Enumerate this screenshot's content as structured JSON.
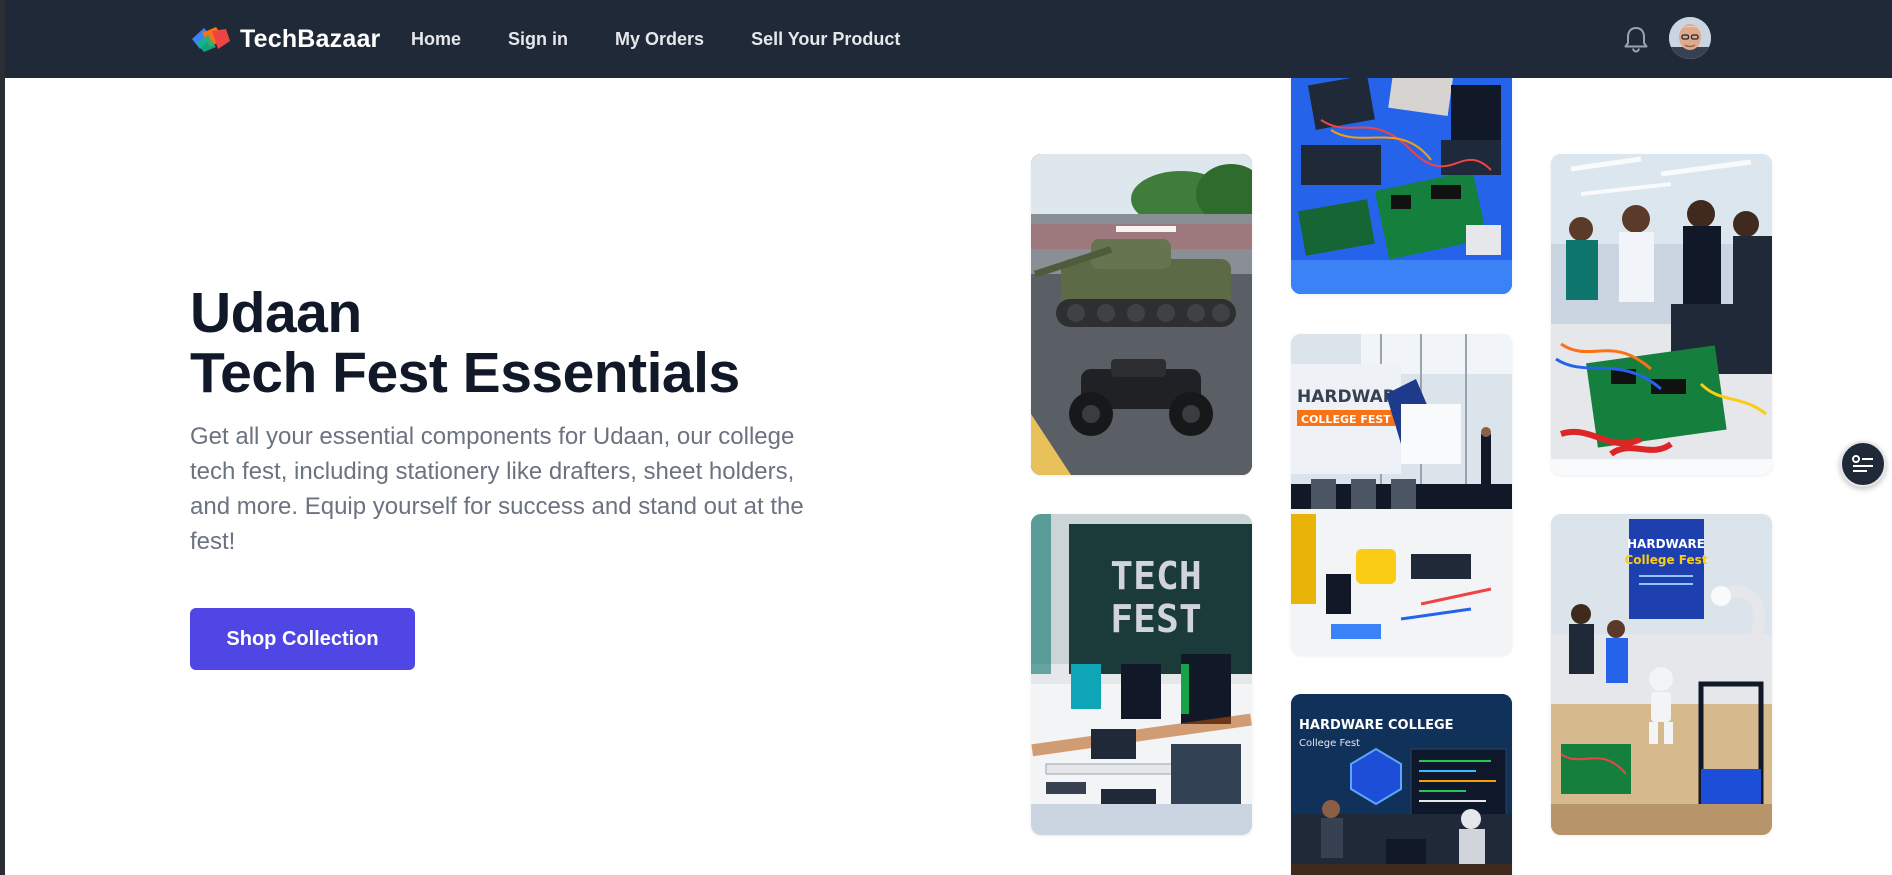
{
  "brand": {
    "name": "TechBazaar"
  },
  "nav": {
    "items": [
      {
        "label": "Home"
      },
      {
        "label": "Sign in"
      },
      {
        "label": "My Orders"
      },
      {
        "label": "Sell Your Product"
      }
    ]
  },
  "header_icons": [
    "bell-icon",
    "user-avatar"
  ],
  "hero": {
    "title_line1": "Udaan",
    "title_line2": "Tech Fest Essentials",
    "description": "Get all your essential components for Udaan, our college tech fest, including stationery like drafters, sheet holders, and more. Equip yourself for success and stand out at the fest!",
    "cta_label": "Shop Collection"
  },
  "gallery": {
    "tiles": [
      {
        "name": "rc-tank-and-car-photo"
      },
      {
        "name": "tech-fest-lab-photo",
        "sign_line1": "TECH",
        "sign_line2": "FEST"
      },
      {
        "name": "hardware-bench-photo"
      },
      {
        "name": "hardware-college-fest-stage-photo",
        "banner_line1": "HARDWARE",
        "banner_line2": "COLLEGE FEST"
      },
      {
        "name": "hardware-college-screen-photo",
        "banner_line1": "HARDWARE COLLEGE",
        "banner_line2": "College Fest"
      },
      {
        "name": "students-circuit-board-photo"
      },
      {
        "name": "robot-expo-photo",
        "banner_line1": "HARDWARE",
        "banner_line2": "College Fest"
      }
    ]
  },
  "colors": {
    "navbar_bg": "#1f2937",
    "primary_button": "#4f46e5",
    "heading": "#111827",
    "body_text": "#6b7280"
  }
}
